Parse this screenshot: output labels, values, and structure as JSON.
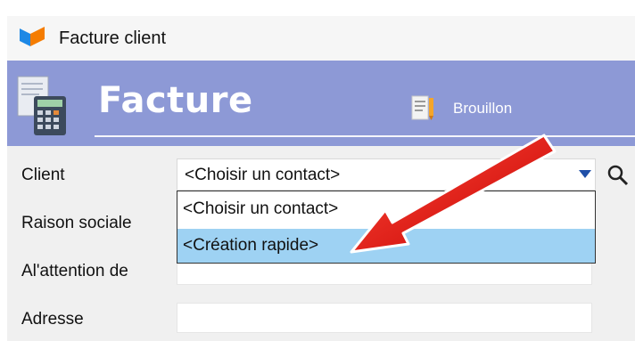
{
  "window": {
    "title": "Facture client"
  },
  "header": {
    "title": "Facture",
    "status": "Brouillon"
  },
  "form": {
    "client_label": "Client",
    "client_value": "<Choisir un contact>",
    "raison_label": "Raison sociale",
    "attention_label": "Al'attention de",
    "adresse_label": "Adresse"
  },
  "dropdown": {
    "items": [
      {
        "label": "<Choisir un contact>"
      },
      {
        "label": "<Création rapide>"
      }
    ]
  },
  "colors": {
    "header_bg": "#8d99d6",
    "selection": "#9ed2f3",
    "arrow": "#e31212"
  },
  "icons": [
    "app-logo-icon",
    "calculator-document-icon",
    "draft-document-icon",
    "chevron-down-icon",
    "search-icon",
    "red-arrow-annotation"
  ]
}
